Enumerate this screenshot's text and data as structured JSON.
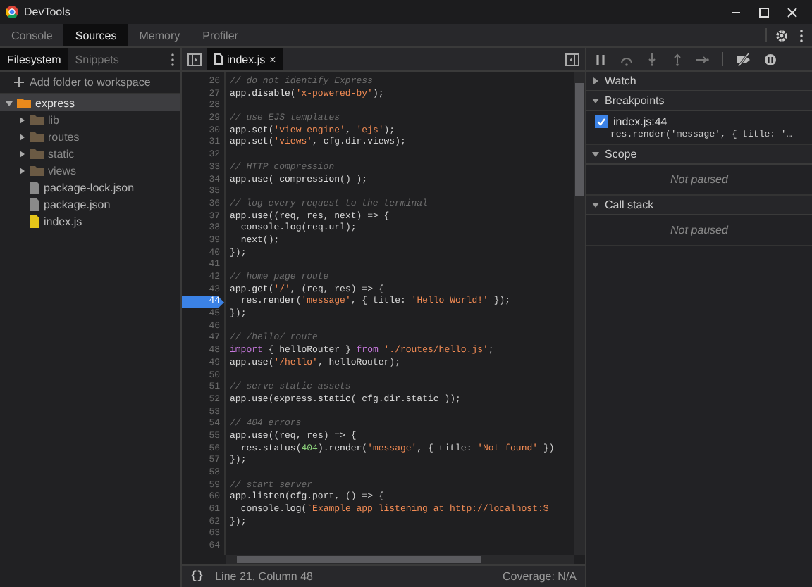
{
  "window": {
    "title": "DevTools"
  },
  "tabs": [
    {
      "label": "Console",
      "selected": false
    },
    {
      "label": "Sources",
      "selected": true
    },
    {
      "label": "Memory",
      "selected": false
    },
    {
      "label": "Profiler",
      "selected": false
    }
  ],
  "navigator": {
    "tabs": [
      {
        "label": "Filesystem",
        "selected": true
      },
      {
        "label": "Snippets",
        "selected": false
      }
    ],
    "add_folder": "Add folder to workspace",
    "tree": [
      {
        "name": "express",
        "kind": "folder",
        "expanded": true,
        "selected": true,
        "children": [
          {
            "name": "lib",
            "kind": "folder",
            "expanded": false,
            "selected": false
          },
          {
            "name": "routes",
            "kind": "folder",
            "expanded": false,
            "selected": false
          },
          {
            "name": "static",
            "kind": "folder",
            "expanded": false,
            "selected": false
          },
          {
            "name": "views",
            "kind": "folder",
            "expanded": false,
            "selected": false
          },
          {
            "name": "package-lock.json",
            "kind": "json",
            "selected": false
          },
          {
            "name": "package.json",
            "kind": "json",
            "selected": false
          },
          {
            "name": "index.js",
            "kind": "js",
            "selected": false
          }
        ]
      }
    ]
  },
  "editor": {
    "tab": "index.js",
    "close": "×",
    "lines": [
      {
        "n": "26",
        "code": "// do not identify Express",
        "breakpoint": false
      },
      {
        "n": "27",
        "code": "app.disable('x-powered-by');",
        "breakpoint": false
      },
      {
        "n": "28",
        "breakpoint": false
      },
      {
        "n": "29",
        "code": "// use EJS templates",
        "breakpoint": false
      },
      {
        "n": "30",
        "code": "app.set('view engine', 'ejs');",
        "breakpoint": false
      },
      {
        "n": "31",
        "code": "app.set('views', cfg.dir.views);",
        "breakpoint": false
      },
      {
        "n": "32",
        "breakpoint": false
      },
      {
        "n": "33",
        "code": "// HTTP compression",
        "breakpoint": false
      },
      {
        "n": "34",
        "code": "app.use( compression() );",
        "breakpoint": false
      },
      {
        "n": "35",
        "breakpoint": false
      },
      {
        "n": "36",
        "code": "// log every request to the terminal",
        "breakpoint": false
      },
      {
        "n": "37",
        "code": "app.use((req, res, next) => {",
        "breakpoint": false
      },
      {
        "n": "38",
        "code": "  console.log(req.url);",
        "breakpoint": false
      },
      {
        "n": "39",
        "code": "  next();",
        "breakpoint": false
      },
      {
        "n": "40",
        "code": "});",
        "breakpoint": false
      },
      {
        "n": "41",
        "breakpoint": false
      },
      {
        "n": "42",
        "code": "// home page route",
        "breakpoint": false
      },
      {
        "n": "43",
        "code": "app.get('/', (req, res) => {",
        "breakpoint": false
      },
      {
        "n": "44",
        "code": "  res.render('message', { title: 'Hello World!' });",
        "breakpoint": true
      },
      {
        "n": "45",
        "code": "});",
        "breakpoint": false
      },
      {
        "n": "46",
        "breakpoint": false
      },
      {
        "n": "47",
        "code": "// /hello/ route",
        "breakpoint": false
      },
      {
        "n": "48",
        "code": "import { helloRouter } from './routes/hello.js';",
        "breakpoint": false
      },
      {
        "n": "49",
        "code": "app.use('/hello', helloRouter);",
        "breakpoint": false
      },
      {
        "n": "50",
        "breakpoint": false
      },
      {
        "n": "51",
        "code": "// serve static assets",
        "breakpoint": false
      },
      {
        "n": "52",
        "code": "app.use(express.static( cfg.dir.static ));",
        "breakpoint": false
      },
      {
        "n": "53",
        "breakpoint": false
      },
      {
        "n": "54",
        "code": "// 404 errors",
        "breakpoint": false
      },
      {
        "n": "55",
        "code": "app.use((req, res) => {",
        "breakpoint": false
      },
      {
        "n": "56",
        "code": "  res.status(404).render('message', { title: 'Not found' })",
        "breakpoint": false
      },
      {
        "n": "57",
        "code": "});",
        "breakpoint": false
      },
      {
        "n": "58",
        "breakpoint": false
      },
      {
        "n": "59",
        "code": "// start server",
        "breakpoint": false
      },
      {
        "n": "60",
        "code": "app.listen(cfg.port, () => {",
        "breakpoint": false
      },
      {
        "n": "61",
        "code": "  console.log(`Example app listening at http://localhost:$",
        "breakpoint": false
      },
      {
        "n": "62",
        "code": "});",
        "breakpoint": false
      },
      {
        "n": "63",
        "breakpoint": false
      },
      {
        "n": "64",
        "breakpoint": false
      }
    ]
  },
  "status_bar": {
    "braces": "{}",
    "position": "Line 21, Column 48",
    "coverage": "Coverage: N/A"
  },
  "debugger": {
    "sections": [
      {
        "title": "Watch",
        "expanded": false
      },
      {
        "title": "Breakpoints",
        "expanded": true,
        "breakpoints": [
          {
            "file": "index.js:44",
            "code": "res.render('message', { title: '…",
            "checked": true
          }
        ]
      },
      {
        "title": "Scope",
        "expanded": true,
        "message": "Not paused"
      },
      {
        "title": "Call stack",
        "expanded": true,
        "message": "Not paused"
      }
    ]
  }
}
